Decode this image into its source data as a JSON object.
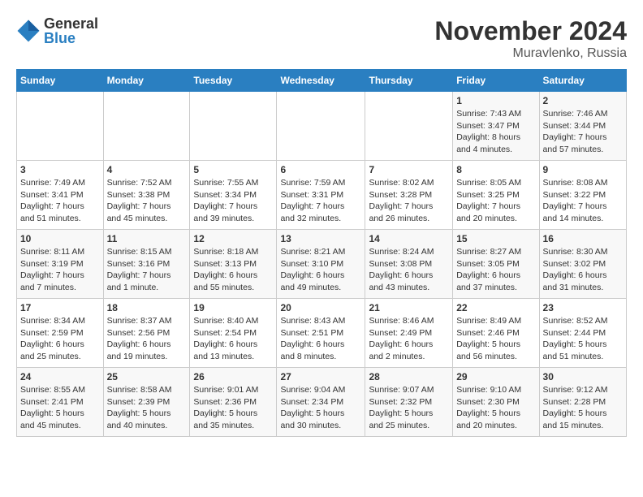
{
  "logo": {
    "general": "General",
    "blue": "Blue"
  },
  "title": "November 2024",
  "location": "Muravlenko, Russia",
  "days_of_week": [
    "Sunday",
    "Monday",
    "Tuesday",
    "Wednesday",
    "Thursday",
    "Friday",
    "Saturday"
  ],
  "weeks": [
    [
      {
        "day": "",
        "info": ""
      },
      {
        "day": "",
        "info": ""
      },
      {
        "day": "",
        "info": ""
      },
      {
        "day": "",
        "info": ""
      },
      {
        "day": "",
        "info": ""
      },
      {
        "day": "1",
        "info": "Sunrise: 7:43 AM\nSunset: 3:47 PM\nDaylight: 8 hours\nand 4 minutes."
      },
      {
        "day": "2",
        "info": "Sunrise: 7:46 AM\nSunset: 3:44 PM\nDaylight: 7 hours\nand 57 minutes."
      }
    ],
    [
      {
        "day": "3",
        "info": "Sunrise: 7:49 AM\nSunset: 3:41 PM\nDaylight: 7 hours\nand 51 minutes."
      },
      {
        "day": "4",
        "info": "Sunrise: 7:52 AM\nSunset: 3:38 PM\nDaylight: 7 hours\nand 45 minutes."
      },
      {
        "day": "5",
        "info": "Sunrise: 7:55 AM\nSunset: 3:34 PM\nDaylight: 7 hours\nand 39 minutes."
      },
      {
        "day": "6",
        "info": "Sunrise: 7:59 AM\nSunset: 3:31 PM\nDaylight: 7 hours\nand 32 minutes."
      },
      {
        "day": "7",
        "info": "Sunrise: 8:02 AM\nSunset: 3:28 PM\nDaylight: 7 hours\nand 26 minutes."
      },
      {
        "day": "8",
        "info": "Sunrise: 8:05 AM\nSunset: 3:25 PM\nDaylight: 7 hours\nand 20 minutes."
      },
      {
        "day": "9",
        "info": "Sunrise: 8:08 AM\nSunset: 3:22 PM\nDaylight: 7 hours\nand 14 minutes."
      }
    ],
    [
      {
        "day": "10",
        "info": "Sunrise: 8:11 AM\nSunset: 3:19 PM\nDaylight: 7 hours\nand 7 minutes."
      },
      {
        "day": "11",
        "info": "Sunrise: 8:15 AM\nSunset: 3:16 PM\nDaylight: 7 hours\nand 1 minute."
      },
      {
        "day": "12",
        "info": "Sunrise: 8:18 AM\nSunset: 3:13 PM\nDaylight: 6 hours\nand 55 minutes."
      },
      {
        "day": "13",
        "info": "Sunrise: 8:21 AM\nSunset: 3:10 PM\nDaylight: 6 hours\nand 49 minutes."
      },
      {
        "day": "14",
        "info": "Sunrise: 8:24 AM\nSunset: 3:08 PM\nDaylight: 6 hours\nand 43 minutes."
      },
      {
        "day": "15",
        "info": "Sunrise: 8:27 AM\nSunset: 3:05 PM\nDaylight: 6 hours\nand 37 minutes."
      },
      {
        "day": "16",
        "info": "Sunrise: 8:30 AM\nSunset: 3:02 PM\nDaylight: 6 hours\nand 31 minutes."
      }
    ],
    [
      {
        "day": "17",
        "info": "Sunrise: 8:34 AM\nSunset: 2:59 PM\nDaylight: 6 hours\nand 25 minutes."
      },
      {
        "day": "18",
        "info": "Sunrise: 8:37 AM\nSunset: 2:56 PM\nDaylight: 6 hours\nand 19 minutes."
      },
      {
        "day": "19",
        "info": "Sunrise: 8:40 AM\nSunset: 2:54 PM\nDaylight: 6 hours\nand 13 minutes."
      },
      {
        "day": "20",
        "info": "Sunrise: 8:43 AM\nSunset: 2:51 PM\nDaylight: 6 hours\nand 8 minutes."
      },
      {
        "day": "21",
        "info": "Sunrise: 8:46 AM\nSunset: 2:49 PM\nDaylight: 6 hours\nand 2 minutes."
      },
      {
        "day": "22",
        "info": "Sunrise: 8:49 AM\nSunset: 2:46 PM\nDaylight: 5 hours\nand 56 minutes."
      },
      {
        "day": "23",
        "info": "Sunrise: 8:52 AM\nSunset: 2:44 PM\nDaylight: 5 hours\nand 51 minutes."
      }
    ],
    [
      {
        "day": "24",
        "info": "Sunrise: 8:55 AM\nSunset: 2:41 PM\nDaylight: 5 hours\nand 45 minutes."
      },
      {
        "day": "25",
        "info": "Sunrise: 8:58 AM\nSunset: 2:39 PM\nDaylight: 5 hours\nand 40 minutes."
      },
      {
        "day": "26",
        "info": "Sunrise: 9:01 AM\nSunset: 2:36 PM\nDaylight: 5 hours\nand 35 minutes."
      },
      {
        "day": "27",
        "info": "Sunrise: 9:04 AM\nSunset: 2:34 PM\nDaylight: 5 hours\nand 30 minutes."
      },
      {
        "day": "28",
        "info": "Sunrise: 9:07 AM\nSunset: 2:32 PM\nDaylight: 5 hours\nand 25 minutes."
      },
      {
        "day": "29",
        "info": "Sunrise: 9:10 AM\nSunset: 2:30 PM\nDaylight: 5 hours\nand 20 minutes."
      },
      {
        "day": "30",
        "info": "Sunrise: 9:12 AM\nSunset: 2:28 PM\nDaylight: 5 hours\nand 15 minutes."
      }
    ]
  ]
}
